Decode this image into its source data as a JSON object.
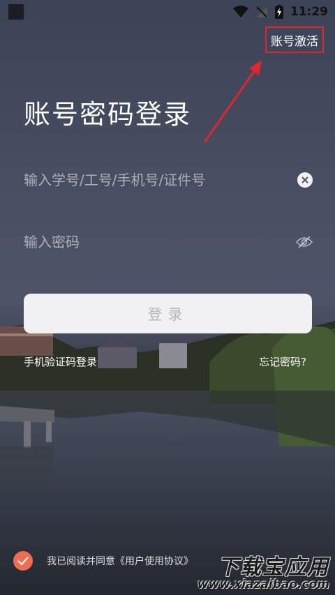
{
  "status_bar": {
    "time": "11:29"
  },
  "header": {
    "activate_label": "账号激活"
  },
  "title": "账号密码登录",
  "account_field": {
    "placeholder": "输入学号/工号/手机号/证件号"
  },
  "password_field": {
    "placeholder": "输入密码"
  },
  "login_button": {
    "label": "登录"
  },
  "links": {
    "sms_login": "手机验证码登录",
    "forgot_password": "忘记密码?"
  },
  "agreement": {
    "prefix": "我已阅读并同意",
    "link": "《用户使用协议》"
  },
  "watermark": {
    "name": "下载宝应用",
    "url": "www.xiazaibao.com"
  },
  "colors": {
    "accent": "#f06c52",
    "highlight_box": "#e0252c",
    "button_bg": "#f1f1f3"
  }
}
